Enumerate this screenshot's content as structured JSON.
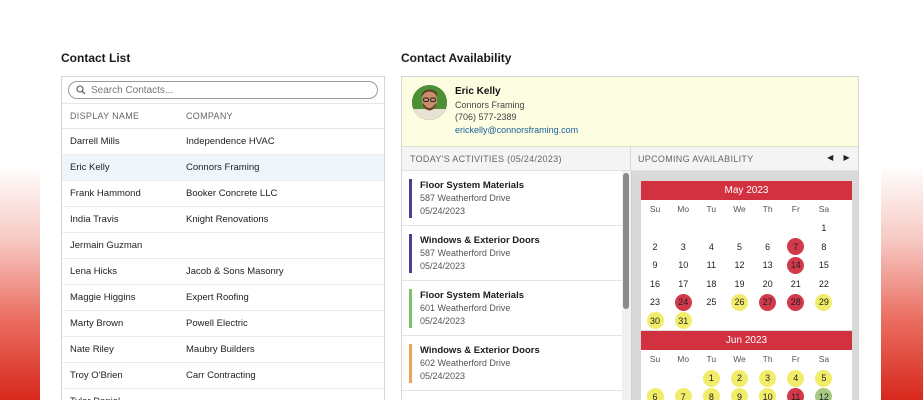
{
  "contact_list": {
    "title": "Contact List",
    "search_placeholder": "Search Contacts...",
    "columns": [
      "DISPLAY NAME",
      "COMPANY"
    ],
    "rows": [
      {
        "name": "Darrell Mills",
        "company": "Independence HVAC"
      },
      {
        "name": "Eric Kelly",
        "company": "Connors Framing",
        "selected": true
      },
      {
        "name": "Frank Hammond",
        "company": "Booker Concrete LLC"
      },
      {
        "name": "India Travis",
        "company": "Knight Renovations"
      },
      {
        "name": "Jermain Guzman",
        "company": ""
      },
      {
        "name": "Lena Hicks",
        "company": "Jacob & Sons Masonry"
      },
      {
        "name": "Maggie Higgins",
        "company": "Expert Roofing"
      },
      {
        "name": "Marty Brown",
        "company": "Powell Electric"
      },
      {
        "name": "Nate Riley",
        "company": "Maubry Builders"
      },
      {
        "name": "Troy O'Brien",
        "company": "Carr Contracting"
      },
      {
        "name": "Tyler Daniel",
        "company": ""
      }
    ]
  },
  "availability": {
    "title": "Contact Availability",
    "contact": {
      "name": "Eric Kelly",
      "company": "Connors Framing",
      "phone": "(706) 577-2389",
      "email": "erickelly@connorsframing.com"
    },
    "activities_header": "TODAY'S ACTIVITIES (05/24/2023)",
    "upcoming_header": "UPCOMING AVAILABILITY",
    "prev_icon": "◀",
    "next_icon": "▶",
    "activities": [
      {
        "title": "Floor System Materials",
        "address": "587 Weatherford Drive",
        "date": "05/24/2023",
        "color": "#4b3f8f"
      },
      {
        "title": "Windows & Exterior Doors",
        "address": "587 Weatherford Drive",
        "date": "05/24/2023",
        "color": "#4b3f8f"
      },
      {
        "title": "Floor System Materials",
        "address": "601 Weatherford Drive",
        "date": "05/24/2023",
        "color": "#7cc26a"
      },
      {
        "title": "Windows & Exterior Doors",
        "address": "602 Weatherford Drive",
        "date": "05/24/2023",
        "color": "#f0a255"
      }
    ],
    "weekdays": [
      "Su",
      "Mo",
      "Tu",
      "We",
      "Th",
      "Fr",
      "Sa"
    ],
    "months": [
      {
        "label": "May 2023",
        "weeks": [
          [
            null,
            null,
            null,
            null,
            null,
            null,
            {
              "d": "1"
            }
          ],
          [
            {
              "d": "2"
            },
            {
              "d": "3"
            },
            {
              "d": "4"
            },
            {
              "d": "5"
            },
            {
              "d": "6"
            },
            {
              "d": "7",
              "s": "busy"
            },
            {
              "d": "8"
            }
          ],
          [
            {
              "d": "9"
            },
            {
              "d": "10"
            },
            {
              "d": "11"
            },
            {
              "d": "12"
            },
            {
              "d": "13"
            },
            {
              "d": "14",
              "s": "busy"
            },
            {
              "d": "15"
            }
          ],
          [
            {
              "d": "16"
            },
            {
              "d": "17"
            },
            {
              "d": "18"
            },
            {
              "d": "19"
            },
            {
              "d": "20"
            },
            {
              "d": "21"
            },
            {
              "d": "22"
            }
          ],
          [
            {
              "d": "23"
            },
            {
              "d": "24",
              "s": "busy"
            },
            {
              "d": "25"
            },
            {
              "d": "26",
              "s": "partial"
            },
            {
              "d": "27",
              "s": "busy"
            },
            {
              "d": "28",
              "s": "busy"
            },
            {
              "d": "29",
              "s": "partial"
            }
          ],
          [
            {
              "d": "30",
              "s": "partial"
            },
            {
              "d": "31",
              "s": "partial"
            },
            null,
            null,
            null,
            null,
            null
          ]
        ]
      },
      {
        "label": "Jun 2023",
        "weeks": [
          [
            null,
            null,
            {
              "d": "1",
              "s": "partial"
            },
            {
              "d": "2",
              "s": "partial"
            },
            {
              "d": "3",
              "s": "partial"
            },
            {
              "d": "4",
              "s": "partial"
            },
            {
              "d": "5",
              "s": "partial"
            }
          ],
          [
            {
              "d": "6",
              "s": "partial"
            },
            {
              "d": "7",
              "s": "partial"
            },
            {
              "d": "8",
              "s": "partial"
            },
            {
              "d": "9",
              "s": "partial"
            },
            {
              "d": "10",
              "s": "partial"
            },
            {
              "d": "11",
              "s": "busy"
            },
            {
              "d": "12",
              "s": "free"
            }
          ]
        ]
      }
    ]
  }
}
